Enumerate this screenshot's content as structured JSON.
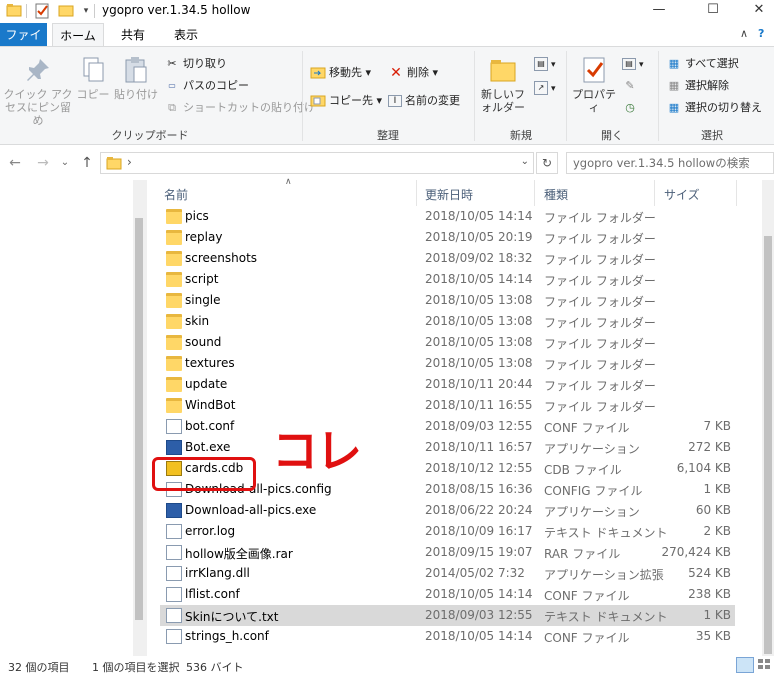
{
  "window": {
    "title": "ygopro ver.1.34.5 hollow",
    "minimize": "—",
    "maximize": "☐",
    "close": "✕"
  },
  "ribbon_tabs": {
    "file": "ファイル",
    "home": "ホーム",
    "share": "共有",
    "view": "表示"
  },
  "ribbon": {
    "clipboard": {
      "pin_label": "クイック アクセスにピン留め",
      "copy_label": "コピー",
      "paste_label": "貼り付け",
      "cut_label": "切り取り",
      "copy_path_label": "パスのコピー",
      "paste_shortcut_label": "ショートカットの貼り付け",
      "group_label": "クリップボード"
    },
    "organize": {
      "move_to_label": "移動先 ▾",
      "copy_to_label": "コピー先 ▾",
      "delete_label": "削除 ▾",
      "rename_label": "名前の変更",
      "group_label": "整理"
    },
    "new": {
      "new_folder_label": "新しいフォルダー",
      "group_label": "新規"
    },
    "open": {
      "properties_label": "プロパティ",
      "group_label": "開く"
    },
    "select": {
      "select_all_label": "すべて選択",
      "select_none_label": "選択解除",
      "invert_label": "選択の切り替え",
      "group_label": "選択"
    }
  },
  "addressbar": {
    "path_separator": "›",
    "search_placeholder": "ygopro ver.1.34.5 hollowの検索"
  },
  "columns": {
    "name": "名前",
    "date": "更新日時",
    "type": "種類",
    "size": "サイズ"
  },
  "files": [
    {
      "name": "pics",
      "date": "2018/10/05 14:14",
      "type": "ファイル フォルダー",
      "size": "",
      "icon": "folder"
    },
    {
      "name": "replay",
      "date": "2018/10/05 20:19",
      "type": "ファイル フォルダー",
      "size": "",
      "icon": "folder"
    },
    {
      "name": "screenshots",
      "date": "2018/09/02 18:32",
      "type": "ファイル フォルダー",
      "size": "",
      "icon": "folder"
    },
    {
      "name": "script",
      "date": "2018/10/05 14:14",
      "type": "ファイル フォルダー",
      "size": "",
      "icon": "folder"
    },
    {
      "name": "single",
      "date": "2018/10/05 13:08",
      "type": "ファイル フォルダー",
      "size": "",
      "icon": "folder"
    },
    {
      "name": "skin",
      "date": "2018/10/05 13:08",
      "type": "ファイル フォルダー",
      "size": "",
      "icon": "folder"
    },
    {
      "name": "sound",
      "date": "2018/10/05 13:08",
      "type": "ファイル フォルダー",
      "size": "",
      "icon": "folder"
    },
    {
      "name": "textures",
      "date": "2018/10/05 13:08",
      "type": "ファイル フォルダー",
      "size": "",
      "icon": "folder"
    },
    {
      "name": "update",
      "date": "2018/10/11 20:44",
      "type": "ファイル フォルダー",
      "size": "",
      "icon": "folder"
    },
    {
      "name": "WindBot",
      "date": "2018/10/11 16:55",
      "type": "ファイル フォルダー",
      "size": "",
      "icon": "folder"
    },
    {
      "name": "bot.conf",
      "date": "2018/09/03 12:55",
      "type": "CONF ファイル",
      "size": "7 KB",
      "icon": "doc"
    },
    {
      "name": "Bot.exe",
      "date": "2018/10/11 16:57",
      "type": "アプリケーション",
      "size": "272 KB",
      "icon": "exe"
    },
    {
      "name": "cards.cdb",
      "date": "2018/10/12 12:55",
      "type": "CDB ファイル",
      "size": "6,104 KB",
      "icon": "cdb"
    },
    {
      "name": "Download-all-pics.config",
      "date": "2018/08/15 16:36",
      "type": "CONFIG ファイル",
      "size": "1 KB",
      "icon": "doc"
    },
    {
      "name": "Download-all-pics.exe",
      "date": "2018/06/22 20:24",
      "type": "アプリケーション",
      "size": "60 KB",
      "icon": "exe"
    },
    {
      "name": "error.log",
      "date": "2018/10/09 16:17",
      "type": "テキスト ドキュメント",
      "size": "2 KB",
      "icon": "doc"
    },
    {
      "name": "hollow版全画像.rar",
      "date": "2018/09/15 19:07",
      "type": "RAR ファイル",
      "size": "270,424 KB",
      "icon": "doc"
    },
    {
      "name": "irrKlang.dll",
      "date": "2014/05/02 7:32",
      "type": "アプリケーション拡張",
      "size": "524 KB",
      "icon": "doc"
    },
    {
      "name": "lflist.conf",
      "date": "2018/10/05 14:14",
      "type": "CONF ファイル",
      "size": "238 KB",
      "icon": "doc"
    },
    {
      "name": "Skinについて.txt",
      "date": "2018/09/03 12:55",
      "type": "テキスト ドキュメント",
      "size": "1 KB",
      "icon": "doc",
      "highlighted": true
    },
    {
      "name": "strings_h.conf",
      "date": "2018/10/05 14:14",
      "type": "CONF ファイル",
      "size": "35 KB",
      "icon": "doc"
    }
  ],
  "statusbar": {
    "item_count": "32 個の項目",
    "selected": "1 個の項目を選択",
    "size": "536 バイト"
  },
  "annotation": {
    "text": "コレ",
    "color": "#e01010"
  }
}
